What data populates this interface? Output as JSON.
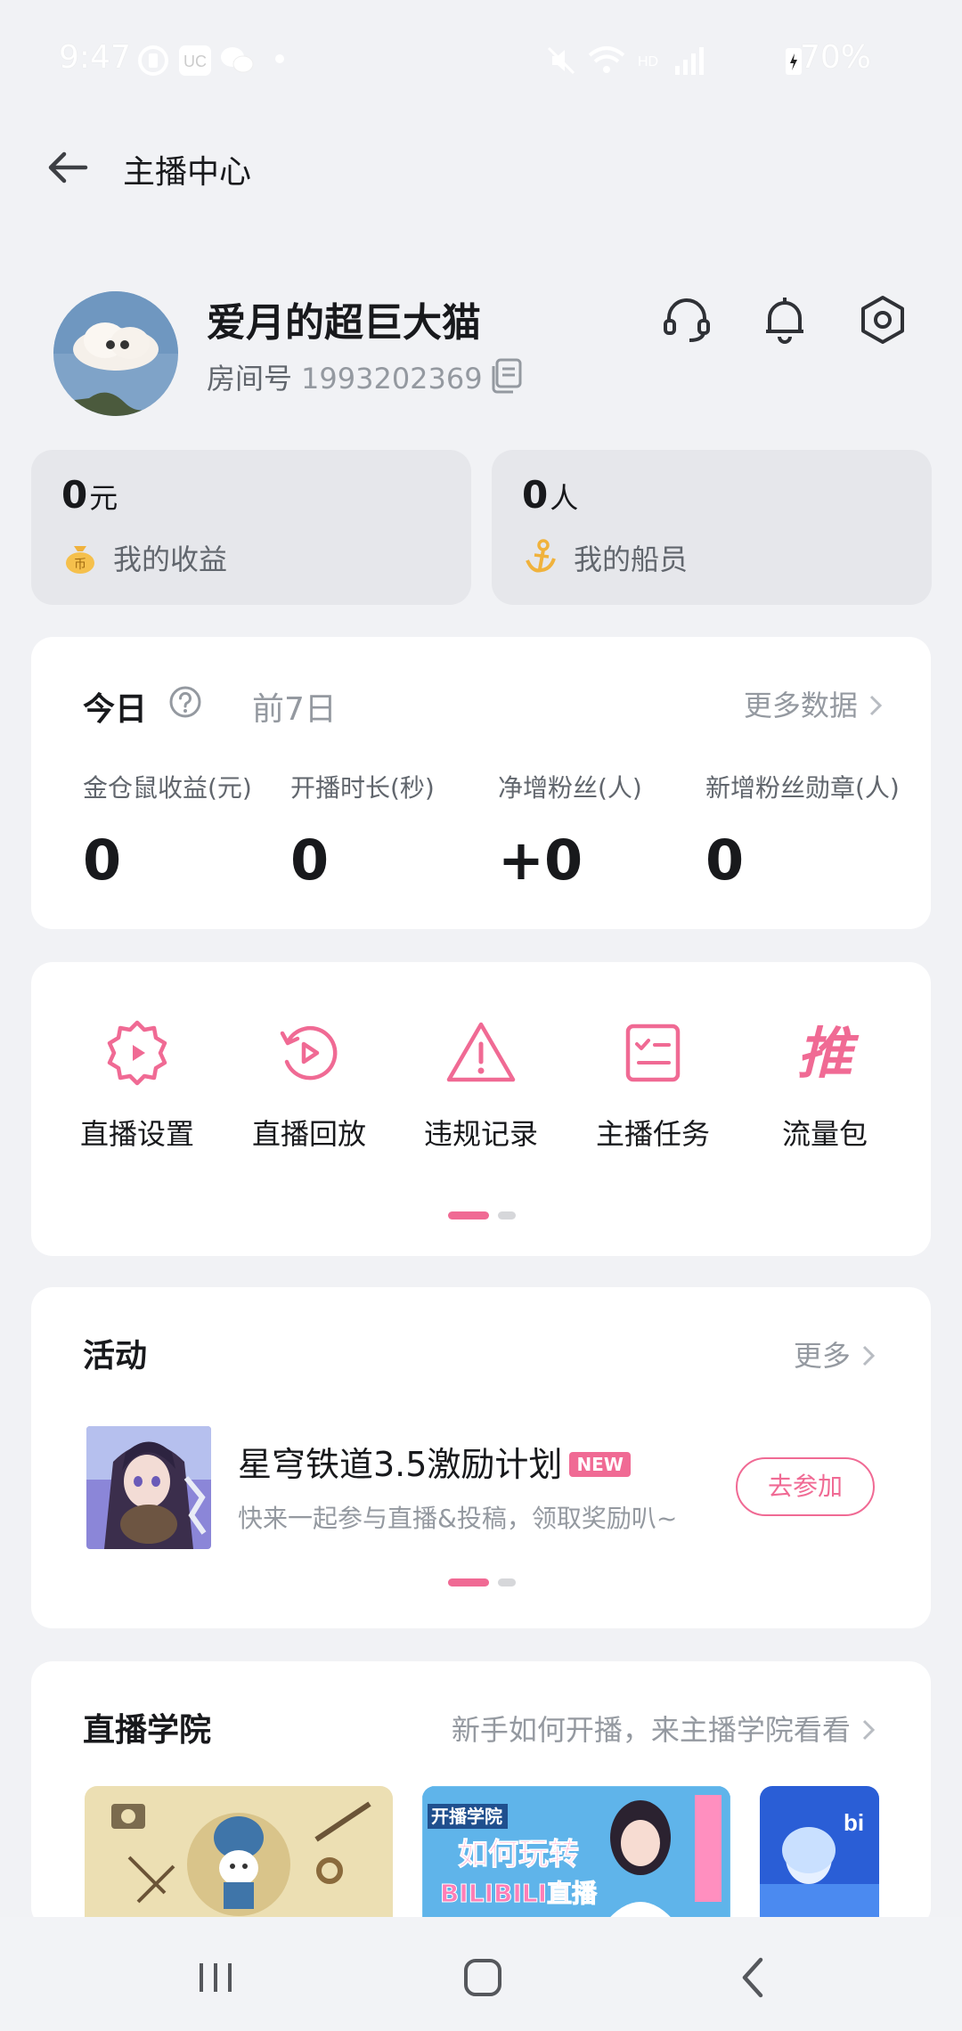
{
  "status_bar": {
    "time": "9:47",
    "battery": "70%"
  },
  "header": {
    "title": "主播中心"
  },
  "profile": {
    "username": "爱月的超巨大猫",
    "room_label": "房间号",
    "room_number": "1993202369"
  },
  "stats": {
    "income_value": "0",
    "income_unit": "元",
    "income_label": "我的收益",
    "crew_value": "0",
    "crew_unit": "人",
    "crew_label": "我的船员"
  },
  "today": {
    "tab_today": "今日",
    "tab_7d": "前7日",
    "more_label": "更多数据",
    "metrics": [
      {
        "label": "金仓鼠收益(元)",
        "value": "0"
      },
      {
        "label": "开播时长(秒)",
        "value": "0"
      },
      {
        "label": "净增粉丝(人)",
        "value": "+0"
      },
      {
        "label": "新增粉丝勋章(人)",
        "value": "0"
      }
    ]
  },
  "tools": [
    {
      "label": "直播设置",
      "icon": "gear-play-icon"
    },
    {
      "label": "直播回放",
      "icon": "replay-icon"
    },
    {
      "label": "违规记录",
      "icon": "warning-icon"
    },
    {
      "label": "主播任务",
      "icon": "checklist-icon"
    },
    {
      "label": "流量包",
      "icon": "tui-icon"
    }
  ],
  "tui_glyph": "推",
  "activity": {
    "title": "活动",
    "more": "更多",
    "item_title": "星穹铁道3.5激励计划",
    "badge": "NEW",
    "item_desc": "快来一起参与直播&投稿，领取奖励叭~",
    "join_label": "去参加"
  },
  "academy": {
    "title": "直播学院",
    "subtitle": "新手如何开播，来主播学院看看",
    "thumb2_line1": "开播学院",
    "thumb2_line2": "如何玩转",
    "thumb2_line3": "BILIBILI直播"
  },
  "colors": {
    "accent": "#f06a94",
    "background": "#f1f2f5",
    "card": "#ffffff"
  }
}
